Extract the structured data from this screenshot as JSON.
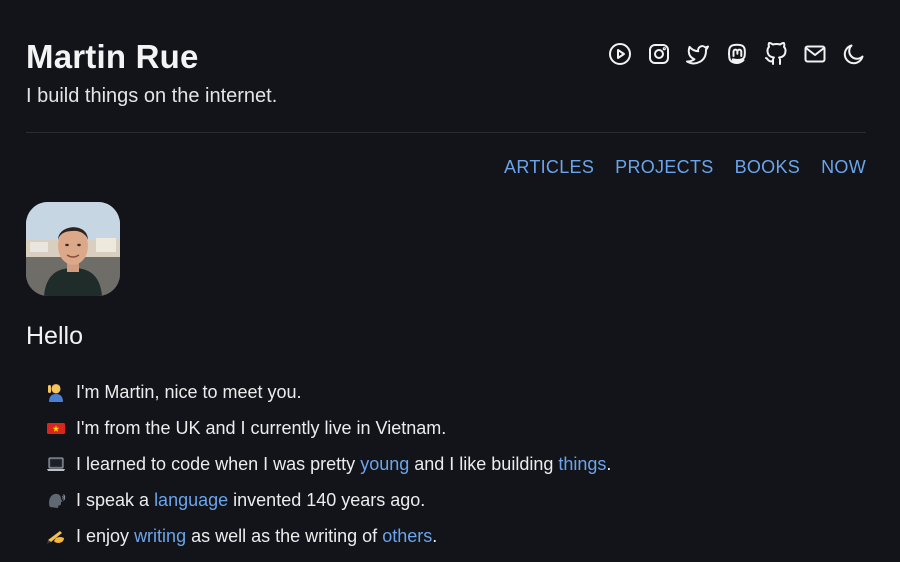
{
  "header": {
    "title": "Martin Rue",
    "tagline": "I build things on the internet."
  },
  "social": [
    {
      "name": "youtube-icon"
    },
    {
      "name": "instagram-icon"
    },
    {
      "name": "twitter-icon"
    },
    {
      "name": "mastodon-icon"
    },
    {
      "name": "github-icon"
    },
    {
      "name": "mail-icon"
    },
    {
      "name": "moon-icon"
    }
  ],
  "nav": {
    "articles": "ARTICLES",
    "projects": "PROJECTS",
    "books": "BOOKS",
    "now": "NOW"
  },
  "main": {
    "heading": "Hello",
    "facts": [
      {
        "icon": "waving-person-emoji",
        "text": "I'm Martin, nice to meet you."
      },
      {
        "icon": "vietnam-flag-emoji",
        "text": "I'm from the UK and I currently live in Vietnam."
      },
      {
        "icon": "laptop-emoji",
        "before": "I learned to code when I was pretty",
        "link1": "young",
        "middle": "and I like building",
        "link2": "things",
        "after": "."
      },
      {
        "icon": "speaking-head-emoji",
        "before": "I speak a",
        "link1": "language",
        "after": "invented 140 years ago."
      },
      {
        "icon": "writing-hand-emoji",
        "before": "I enjoy",
        "link1": "writing",
        "middle": "as well as the writing of",
        "link2": "others",
        "after": "."
      }
    ]
  },
  "colors": {
    "background": "#12141a",
    "text": "#f2f2f2",
    "link": "#6aa4ea"
  }
}
